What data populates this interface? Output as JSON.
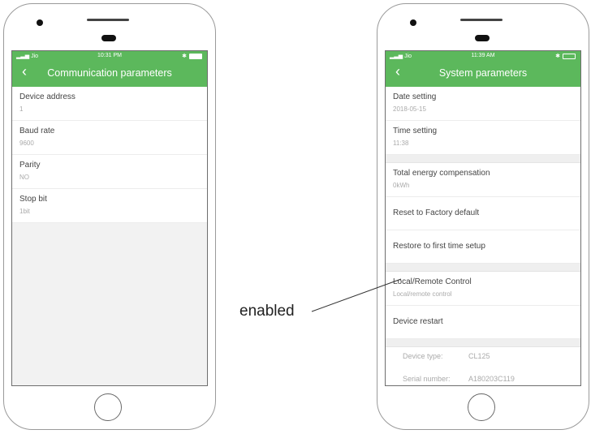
{
  "left_phone": {
    "status": {
      "carrier": "Jio",
      "time": "10:31 PM",
      "bluetooth": "✱"
    },
    "title": "Communication parameters",
    "back_icon": "chevron-left-icon",
    "items": [
      {
        "label": "Device address",
        "value": "1"
      },
      {
        "label": "Baud rate",
        "value": "9600"
      },
      {
        "label": "Parity",
        "value": "NO"
      },
      {
        "label": "Stop bit",
        "value": "1bit"
      }
    ]
  },
  "right_phone": {
    "status": {
      "carrier": "Jio",
      "time": "11:39 AM",
      "bluetooth": "✱"
    },
    "title": "System parameters",
    "back_icon": "chevron-left-icon",
    "group1": [
      {
        "label": "Date setting",
        "value": "2018-05-15"
      },
      {
        "label": "Time setting",
        "value": "11:38"
      }
    ],
    "group2": {
      "energy": {
        "label": "Total energy compensation",
        "value": "0kWh"
      },
      "reset": {
        "label": "Reset to Factory default"
      },
      "restore": {
        "label": "Restore to first time setup"
      }
    },
    "group3": {
      "control": {
        "label": "Local/Remote Control",
        "value": "Local/remote control"
      },
      "restart": {
        "label": "Device restart"
      }
    },
    "info": [
      {
        "key": "Device type:",
        "value": "CL125"
      },
      {
        "key": "Serial number:",
        "value": "A180203C119"
      }
    ]
  },
  "annotation": {
    "text": "enabled"
  },
  "colors": {
    "header_green": "#5cb85c",
    "background": "#f2f2f2"
  }
}
